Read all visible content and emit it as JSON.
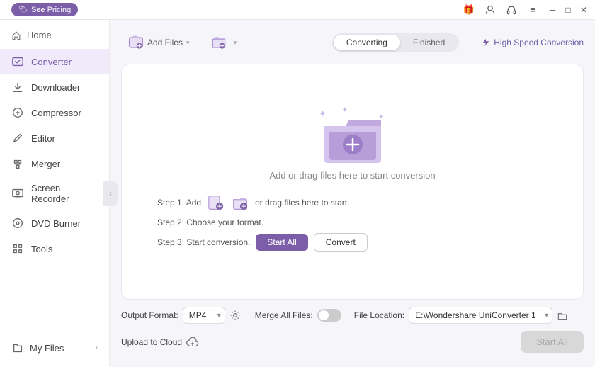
{
  "titlebar": {
    "pricing_label": "See Pricing",
    "pricing_icon": "🏷",
    "gift_icon": "🎁",
    "user_icon": "👤",
    "headset_icon": "🎧",
    "menu_icon": "≡",
    "minimize_icon": "─",
    "maximize_icon": "□",
    "close_icon": "✕"
  },
  "sidebar": {
    "home_label": "Home",
    "items": [
      {
        "id": "converter",
        "label": "Converter",
        "active": true
      },
      {
        "id": "downloader",
        "label": "Downloader",
        "active": false
      },
      {
        "id": "compressor",
        "label": "Compressor",
        "active": false
      },
      {
        "id": "editor",
        "label": "Editor",
        "active": false
      },
      {
        "id": "merger",
        "label": "Merger",
        "active": false
      },
      {
        "id": "screen-recorder",
        "label": "Screen Recorder",
        "active": false
      },
      {
        "id": "dvd-burner",
        "label": "DVD Burner",
        "active": false
      },
      {
        "id": "tools",
        "label": "Tools",
        "active": false
      }
    ],
    "my_files_label": "My Files"
  },
  "toolbar": {
    "add_file_label": "Add Files",
    "add_folder_label": "Add Folder",
    "tab_converting": "Converting",
    "tab_finished": "Finished",
    "high_speed_label": "High Speed Conversion"
  },
  "drop_area": {
    "instruction": "Add or drag files here to start conversion",
    "step1_prefix": "Step 1: Add",
    "step1_suffix": "or drag files here to start.",
    "step2": "Step 2: Choose your format.",
    "step3_prefix": "Step 3: Start conversion.",
    "start_all_label": "Start All",
    "convert_label": "Convert"
  },
  "bottom_bar": {
    "output_format_label": "Output Format:",
    "output_format_value": "MP4",
    "file_location_label": "File Location:",
    "file_location_value": "E:\\Wondershare UniConverter 1",
    "merge_all_label": "Merge All Files:",
    "upload_cloud_label": "Upload to Cloud",
    "start_all_label": "Start All"
  }
}
